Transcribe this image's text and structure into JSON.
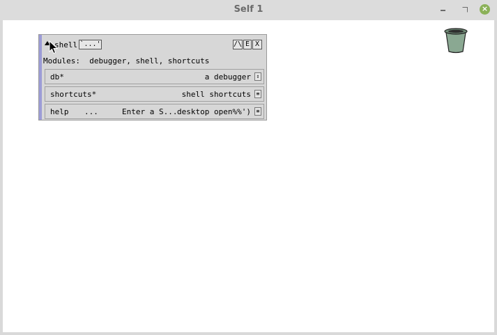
{
  "window": {
    "title": "Self 1",
    "close_glyph": "×"
  },
  "outliner": {
    "object_name": "shell",
    "quote_button": "`...'",
    "caret_button": "/\\",
    "edit_button": "E",
    "close_button": "X",
    "modules_line": "Modules:  debugger, shell, shortcuts",
    "slots": [
      {
        "name": "db*",
        "value": "a debugger",
        "button": "⇕"
      },
      {
        "name": "shortcuts*",
        "value": "shell shortcuts",
        "button": "≡"
      },
      {
        "name": "help",
        "dots": "...",
        "middle": "Enter a S...",
        "value": "desktop open%%')",
        "button": "≡"
      }
    ]
  },
  "icons": {
    "trash": "trash-can-icon",
    "cursor": "mouse-pointer-icon"
  },
  "colors": {
    "outliner_stripe": "#9c9cd6",
    "close_button": "#8bb158"
  }
}
